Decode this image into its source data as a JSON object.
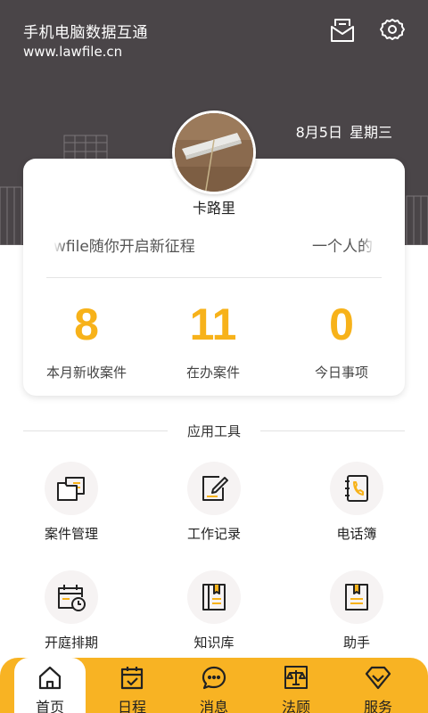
{
  "header": {
    "title": "手机电脑数据互通",
    "url": "www.lawfile.cn",
    "icons": [
      "mail-icon",
      "gear-icon"
    ],
    "date": "8月5日",
    "weekday": "星期三"
  },
  "profile": {
    "username": "卡路里",
    "marquee_text": "wfile随你开启新征程",
    "marquee_text_2": "一个人的"
  },
  "stats": [
    {
      "value": "8",
      "label": "本月新收案件"
    },
    {
      "value": "11",
      "label": "在办案件"
    },
    {
      "value": "0",
      "label": "今日事项"
    }
  ],
  "tools_section": {
    "title": "应用工具",
    "items": [
      {
        "label": "案件管理",
        "icon": "folders-icon"
      },
      {
        "label": "工作记录",
        "icon": "edit-note-icon"
      },
      {
        "label": "电话簿",
        "icon": "phone-book-icon"
      },
      {
        "label": "开庭排期",
        "icon": "calendar-clock-icon"
      },
      {
        "label": "知识库",
        "icon": "book-icon"
      },
      {
        "label": "助手",
        "icon": "assistant-book-icon"
      }
    ]
  },
  "bottom_nav": {
    "items": [
      {
        "label": "首页",
        "icon": "home-icon",
        "active": true
      },
      {
        "label": "日程",
        "icon": "calendar-check-icon",
        "active": false
      },
      {
        "label": "消息",
        "icon": "chat-icon",
        "active": false
      },
      {
        "label": "法顾",
        "icon": "scales-icon",
        "active": false
      },
      {
        "label": "服务",
        "icon": "diamond-icon",
        "active": false
      }
    ]
  },
  "colors": {
    "header_bg": "#4a4548",
    "accent": "#f7b21a",
    "nav_bg": "#f8b323"
  }
}
